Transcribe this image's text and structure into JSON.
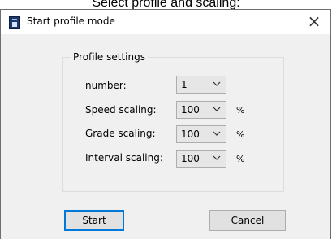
{
  "caption": "Select profile and scaling:",
  "window": {
    "title": "Start profile mode",
    "close_glyph": "×",
    "app_icon": "app-window-icon"
  },
  "profile_settings": {
    "group_title": "Profile settings",
    "rows": [
      {
        "label": "number:",
        "value": "1",
        "unit": ""
      },
      {
        "label": "Speed scaling:",
        "value": "100",
        "unit": "%"
      },
      {
        "label": "Grade scaling:",
        "value": "100",
        "unit": "%"
      },
      {
        "label": "Interval scaling:",
        "value": "100",
        "unit": "%"
      }
    ]
  },
  "buttons": {
    "start": "Start",
    "cancel": "Cancel"
  },
  "colors": {
    "dialog_bg": "#f0f0f0",
    "accent_border": "#0078d7"
  }
}
